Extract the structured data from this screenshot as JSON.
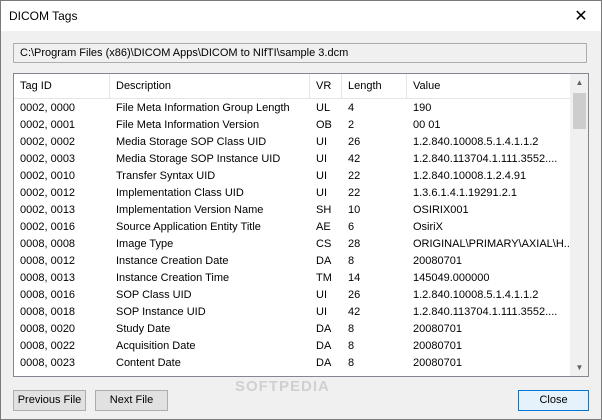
{
  "window": {
    "title": "DICOM Tags",
    "close_glyph": "✕"
  },
  "path": "C:\\Program Files (x86)\\DICOM Apps\\DICOM to NIfTI\\sample 3.dcm",
  "columns": [
    "Tag ID",
    "Description",
    "VR",
    "Length",
    "Value"
  ],
  "rows": [
    [
      "0002, 0000",
      "File Meta Information Group Length",
      "UL",
      "4",
      "190"
    ],
    [
      "0002, 0001",
      "File Meta Information Version",
      "OB",
      "2",
      "00 01"
    ],
    [
      "0002, 0002",
      "Media Storage SOP Class UID",
      "UI",
      "26",
      "1.2.840.10008.5.1.4.1.1.2"
    ],
    [
      "0002, 0003",
      "Media Storage SOP Instance UID",
      "UI",
      "42",
      "1.2.840.113704.1.111.3552...."
    ],
    [
      "0002, 0010",
      "Transfer Syntax UID",
      "UI",
      "22",
      "1.2.840.10008.1.2.4.91"
    ],
    [
      "0002, 0012",
      "Implementation Class UID",
      "UI",
      "22",
      "1.3.6.1.4.1.19291.2.1"
    ],
    [
      "0002, 0013",
      "Implementation Version Name",
      "SH",
      "10",
      "OSIRIX001"
    ],
    [
      "0002, 0016",
      "Source Application Entity Title",
      "AE",
      "6",
      "OsiriX"
    ],
    [
      "0008, 0008",
      "Image Type",
      "CS",
      "28",
      "ORIGINAL\\PRIMARY\\AXIAL\\H..."
    ],
    [
      "0008, 0012",
      "Instance Creation Date",
      "DA",
      "8",
      "20080701"
    ],
    [
      "0008, 0013",
      "Instance Creation Time",
      "TM",
      "14",
      "145049.000000"
    ],
    [
      "0008, 0016",
      "SOP Class UID",
      "UI",
      "26",
      "1.2.840.10008.5.1.4.1.1.2"
    ],
    [
      "0008, 0018",
      "SOP Instance UID",
      "UI",
      "42",
      "1.2.840.113704.1.111.3552...."
    ],
    [
      "0008, 0020",
      "Study Date",
      "DA",
      "8",
      "20080701"
    ],
    [
      "0008, 0022",
      "Acquisition Date",
      "DA",
      "8",
      "20080701"
    ],
    [
      "0008, 0023",
      "Content Date",
      "DA",
      "8",
      "20080701"
    ]
  ],
  "scroll": {
    "up_glyph": "▲",
    "down_glyph": "▼"
  },
  "buttons": {
    "previous": "Previous File",
    "next": "Next File",
    "close": "Close"
  },
  "watermark": "SOFTPEDIA"
}
